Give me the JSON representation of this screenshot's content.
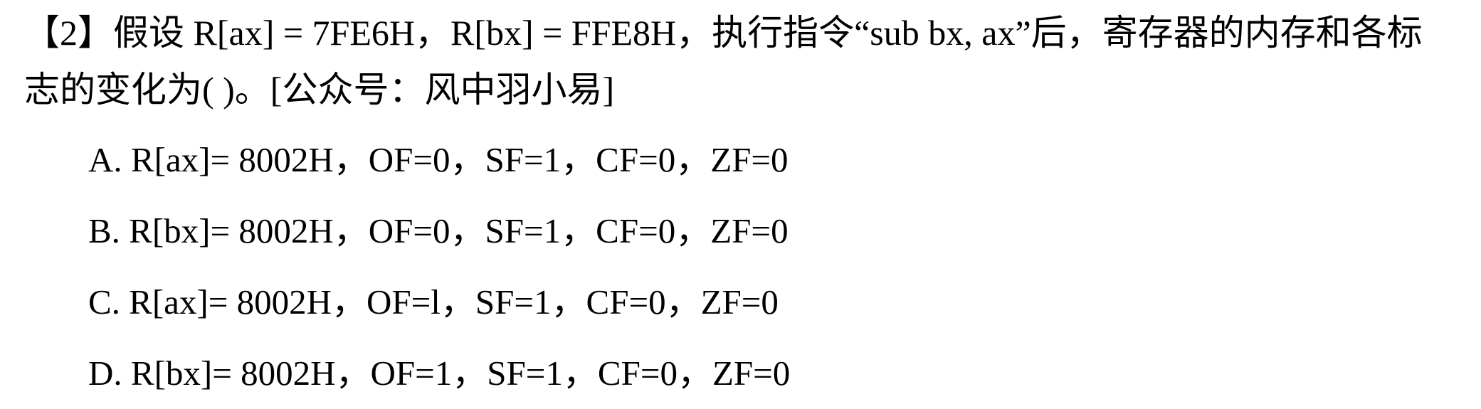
{
  "question": {
    "line1": "【2】假设 R[ax] = 7FE6H，R[bx] = FFE8H，执行指令“sub bx, ax”后，寄存器的内存和各标",
    "line2": "志的变化为(        )。[公众号：风中羽小易]"
  },
  "options": [
    "A. R[ax]= 8002H，OF=0，SF=1，CF=0，ZF=0",
    "B. R[bx]= 8002H，OF=0，SF=1，CF=0，ZF=0",
    "C. R[ax]= 8002H，OF=l，SF=1，CF=0，ZF=0",
    "D. R[bx]= 8002H，OF=1，SF=1，CF=0，ZF=0"
  ]
}
